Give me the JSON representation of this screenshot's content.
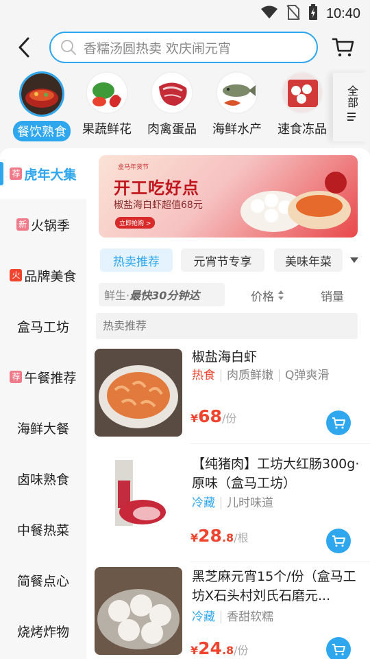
{
  "status_bar": {
    "time": "10:40"
  },
  "search": {
    "placeholder": "香糯汤圆热卖 欢庆闹元宵"
  },
  "categories": [
    {
      "label": "餐饮熟食",
      "icon": "hotpot-icon",
      "active": true
    },
    {
      "label": "果蔬鲜花",
      "icon": "vegetables-icon"
    },
    {
      "label": "肉禽蛋品",
      "icon": "meat-icon"
    },
    {
      "label": "海鲜水产",
      "icon": "fish-icon"
    },
    {
      "label": "速食冻品",
      "icon": "dumplings-icon"
    }
  ],
  "all_categories_label": "全部",
  "sidebar": {
    "items": [
      {
        "label": "虎年大集",
        "tag": "荐",
        "active": true
      },
      {
        "label": "火锅季",
        "tag": "新"
      },
      {
        "label": "品牌美食",
        "tag": "火"
      },
      {
        "label": "盒马工坊"
      },
      {
        "label": "午餐推荐",
        "tag": "荐"
      },
      {
        "label": "海鲜大餐"
      },
      {
        "label": "卤味熟食"
      },
      {
        "label": "中餐热菜"
      },
      {
        "label": "简餐点心"
      },
      {
        "label": "烧烤炸物"
      }
    ]
  },
  "banner": {
    "badge": "盒马年货节",
    "title": "开工吃好点",
    "subtitle": "椒盐海白虾超值68元",
    "button": "立即抢购 >"
  },
  "chips": [
    {
      "label": "热卖推荐",
      "active": true
    },
    {
      "label": "元宵节专享"
    },
    {
      "label": "美味年菜"
    }
  ],
  "filters": {
    "fresh_prefix": "鲜生·",
    "fresh_slogan": "最快30分钟达",
    "price": "价格",
    "sales": "销量"
  },
  "section_title": "热卖推荐",
  "products": [
    {
      "name": "椒盐海白虾",
      "tags": [
        "热食",
        "肉质鲜嫩",
        "Q弹爽滑"
      ],
      "first_tag_color": "#f0442e",
      "currency": "¥",
      "price_int": "68",
      "price_dec": "",
      "unit": "/份"
    },
    {
      "name": "【纯猪肉】工坊大红肠300g·原味（盒马工坊）",
      "tags": [
        "冷藏",
        "儿时味道"
      ],
      "first_tag_color": "#2fa7ef",
      "currency": "¥",
      "price_int": "28",
      "price_dec": ".8",
      "unit": "/根"
    },
    {
      "name": "黑芝麻元宵15个/份（盒马工坊X石头村刘氏石磨元...",
      "tags": [
        "冷藏",
        "香甜软糯"
      ],
      "first_tag_color": "#2fa7ef",
      "currency": "¥",
      "price_int": "24",
      "price_dec": ".8",
      "unit": "/份"
    }
  ],
  "colors": {
    "accent": "#2fa7ef",
    "price": "#f0442e"
  }
}
